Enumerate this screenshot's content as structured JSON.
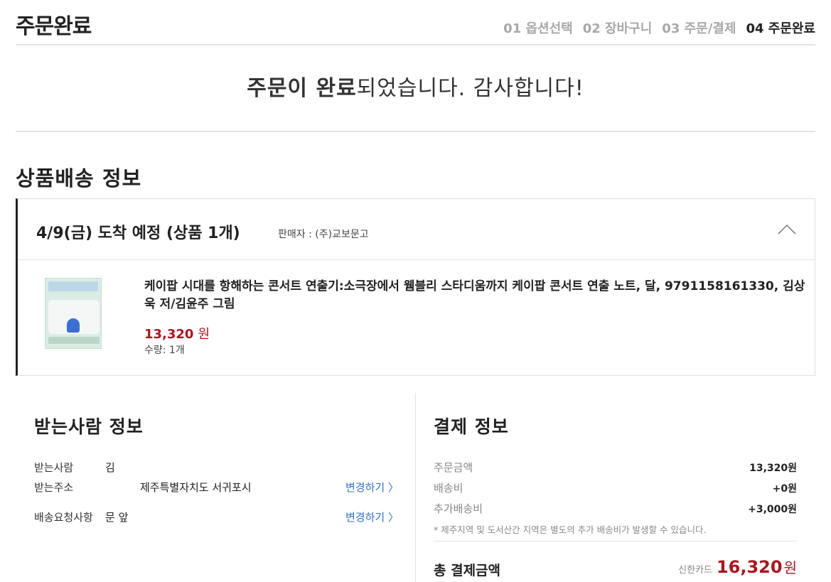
{
  "header": {
    "title": "주문완료",
    "steps": [
      {
        "label": "01 옵션선택"
      },
      {
        "label": "02 장바구니"
      },
      {
        "label": "03 주문/결제"
      },
      {
        "label": "04 주문완료"
      }
    ]
  },
  "banner": {
    "bold_text": "주문이 완료",
    "rest_text": "되었습니다. 감사합니다!"
  },
  "shipping": {
    "section_title": "상품배송 정보",
    "arrival": "4/9(금) 도착 예정 (상품 1개)",
    "seller": "판매자 : (주)교보문고",
    "item": {
      "title": "케이팝 시대를 항해하는 콘서트 연출기:소극장에서 웸블리 스타디움까지 케이팝 콘서트 연출 노트, 달, 9791158161330, 김상욱 저/김윤주 그림",
      "price": "13,320",
      "currency": "원",
      "quantity": "수량: 1개"
    }
  },
  "recipient": {
    "title": "받는사람 정보",
    "name_label": "받는사람",
    "name_value": "김",
    "address_label": "받는주소",
    "address_value": "제주특별자치도 서귀포시",
    "request_label": "배송요청사항",
    "request_value": "문 앞",
    "change_label": "변경하기 〉"
  },
  "payment": {
    "title": "결제 정보",
    "rows": [
      {
        "label": "주문금액",
        "value": "13,320원"
      },
      {
        "label": "배송비",
        "value": "+0원"
      },
      {
        "label": "추가배송비",
        "value": "+3,000원"
      }
    ],
    "note": "* 제주지역 및 도서산간 지역은 별도의 추가 배송비가 발생할 수 있습니다.",
    "total_label": "총 결제금액",
    "card": "신한카드",
    "total_amount": "16,320",
    "total_currency": "원"
  }
}
